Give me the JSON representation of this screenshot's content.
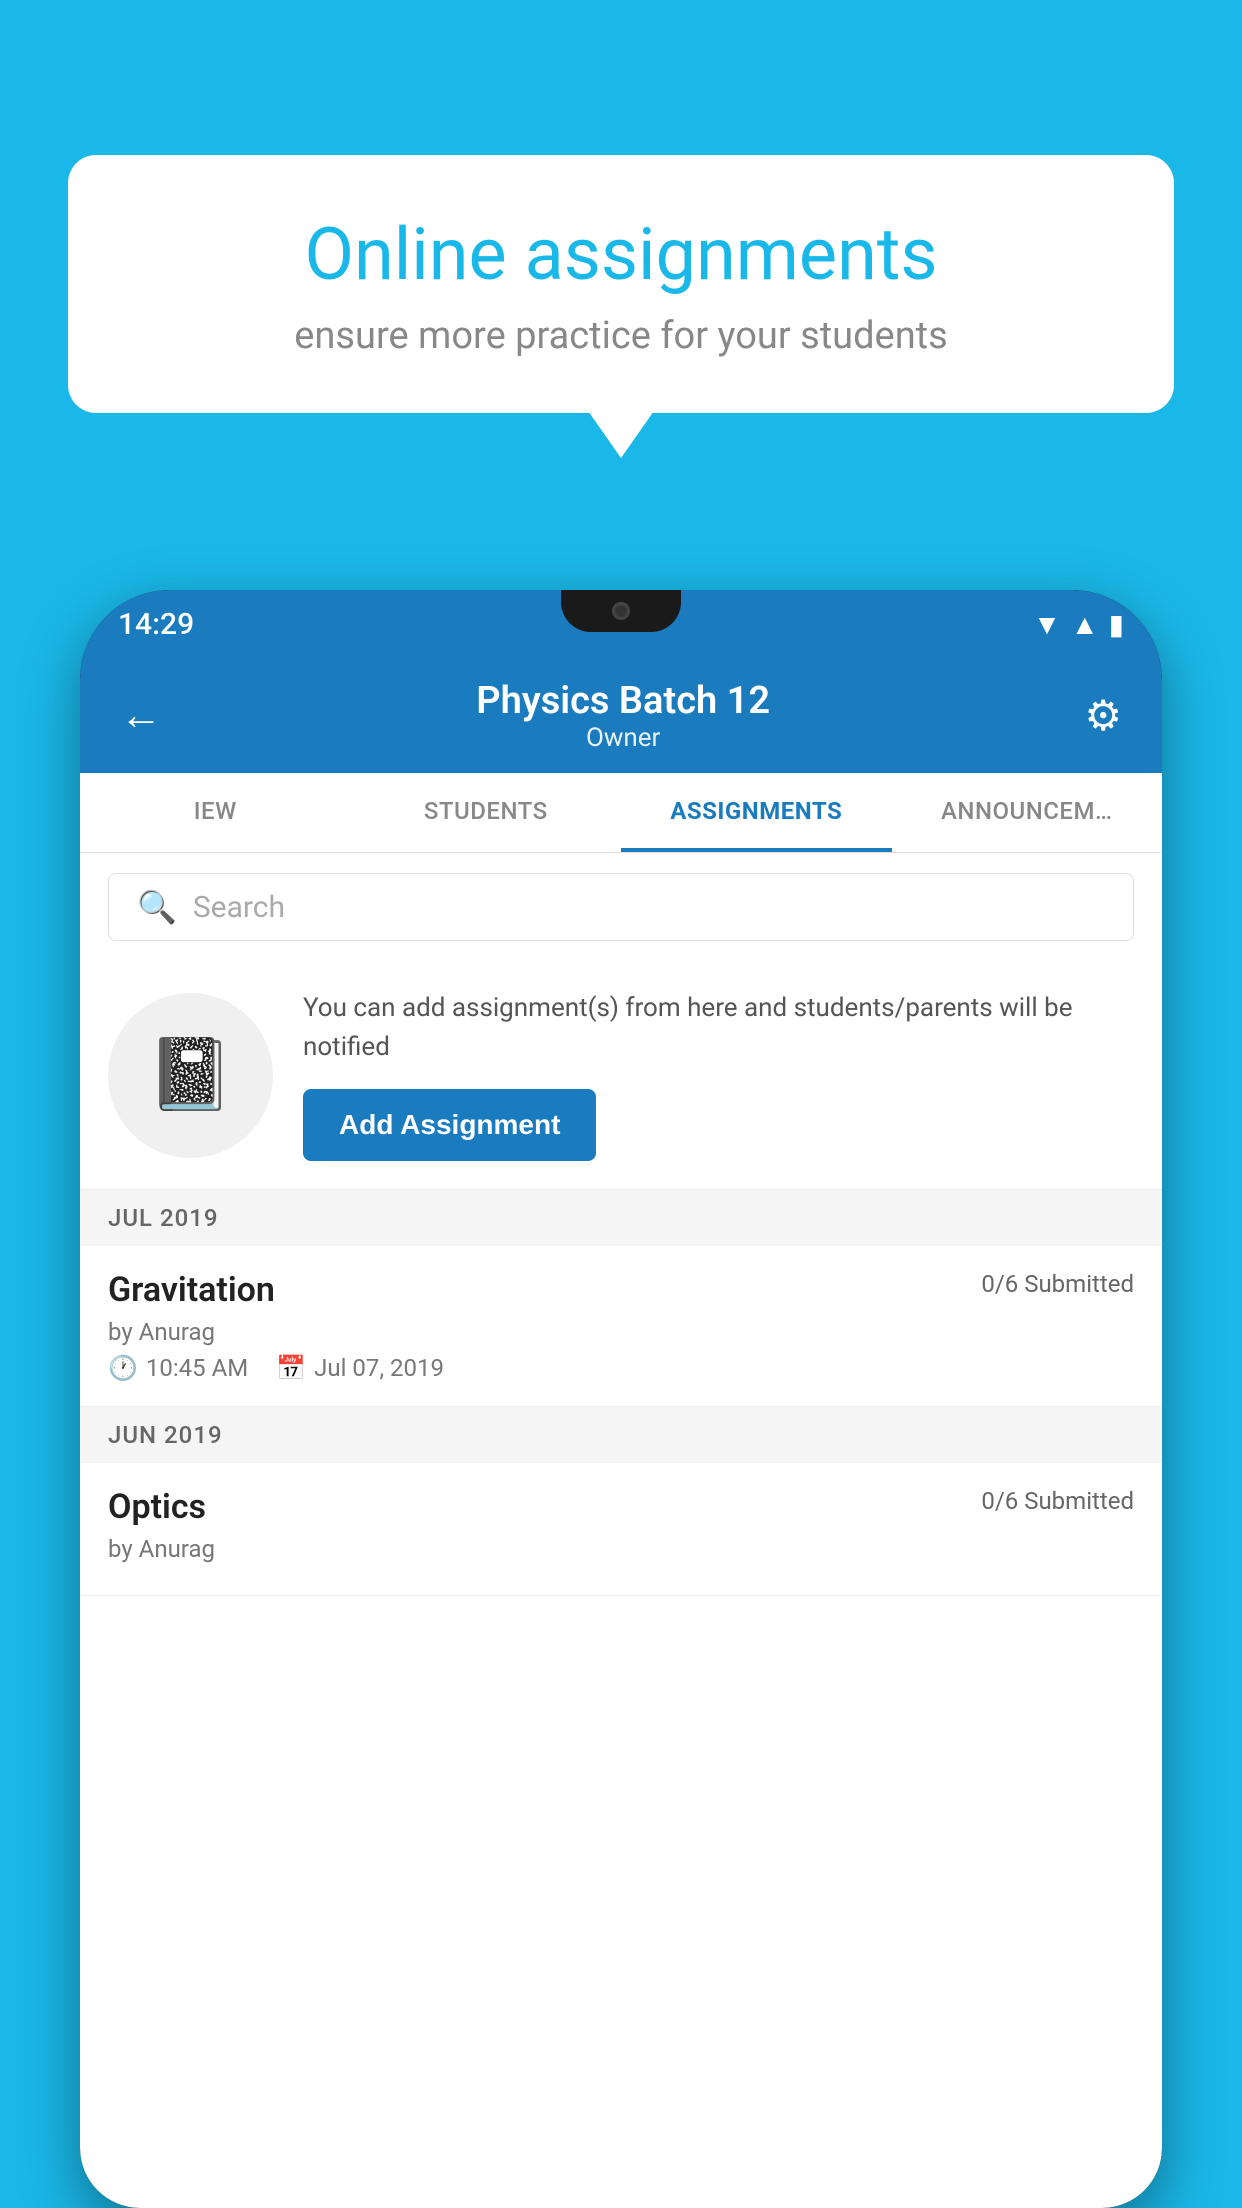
{
  "background_color": "#1ab8e8",
  "speech_bubble": {
    "title": "Online assignments",
    "subtitle": "ensure more practice for your students"
  },
  "phone": {
    "status_bar": {
      "time": "14:29"
    },
    "header": {
      "title": "Physics Batch 12",
      "subtitle": "Owner",
      "back_label": "←",
      "settings_label": "⚙"
    },
    "tabs": [
      {
        "label": "IEW",
        "active": false
      },
      {
        "label": "STUDENTS",
        "active": false
      },
      {
        "label": "ASSIGNMENTS",
        "active": true
      },
      {
        "label": "ANNOUNCEM…",
        "active": false
      }
    ],
    "search": {
      "placeholder": "Search"
    },
    "add_assignment_section": {
      "description": "You can add assignment(s) from here and students/parents will be notified",
      "button_label": "Add Assignment"
    },
    "sections": [
      {
        "label": "JUL 2019",
        "items": [
          {
            "name": "Gravitation",
            "submitted": "0/6 Submitted",
            "by": "by Anurag",
            "time": "10:45 AM",
            "date": "Jul 07, 2019"
          }
        ]
      },
      {
        "label": "JUN 2019",
        "items": [
          {
            "name": "Optics",
            "submitted": "0/6 Submitted",
            "by": "by Anurag",
            "time": "",
            "date": ""
          }
        ]
      }
    ]
  }
}
